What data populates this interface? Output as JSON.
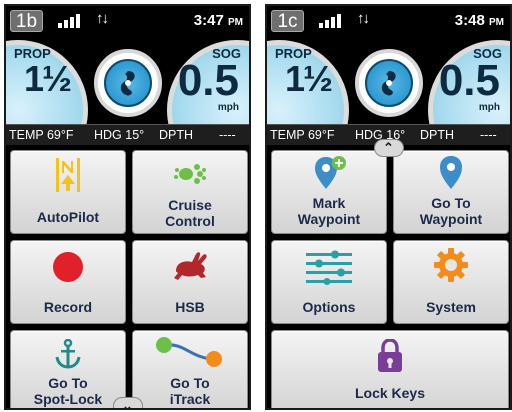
{
  "screens": [
    {
      "label": "1b",
      "time": "3:47",
      "ampm": "PM",
      "arrows": "↑↓",
      "prop": {
        "label": "PROP",
        "value": "1½"
      },
      "sog": {
        "label": "SOG",
        "value": "0.5",
        "unit": "mph"
      },
      "info": {
        "temp": "TEMP 69°F",
        "hdg": "HDG 15°",
        "depth_label": "DPTH",
        "depth_value": "----"
      },
      "tiles": [
        {
          "label": "AutoPilot",
          "icon": "autopilot-icon"
        },
        {
          "label": "Cruise Control",
          "line1": "Cruise",
          "line2": "Control",
          "icon": "cruise-control-icon"
        },
        {
          "label": "Record",
          "icon": "record-icon"
        },
        {
          "label": "HSB",
          "icon": "rabbit-icon"
        },
        {
          "label": "Go To Spot-Lock",
          "line1": "Go To",
          "line2": "Spot-Lock",
          "icon": "anchor-icon"
        },
        {
          "label": "Go To iTrack",
          "line1": "Go To",
          "line2": "iTrack",
          "icon": "itrack-icon"
        }
      ],
      "scroll_arrow": "⌄"
    },
    {
      "label": "1c",
      "time": "3:48",
      "ampm": "PM",
      "arrows": "↑↓",
      "prop": {
        "label": "PROP",
        "value": "1½"
      },
      "sog": {
        "label": "SOG",
        "value": "0.5",
        "unit": "mph"
      },
      "info": {
        "temp": "TEMP 69°F",
        "hdg": "HDG 16°",
        "depth_label": "DPTH",
        "depth_value": "----"
      },
      "tiles": [
        {
          "label": "Mark Waypoint",
          "line1": "Mark",
          "line2": "Waypoint",
          "icon": "mark-waypoint-icon"
        },
        {
          "label": "Go To Waypoint",
          "line1": "Go To",
          "line2": "Waypoint",
          "icon": "waypoint-pin-icon"
        },
        {
          "label": "Options",
          "icon": "sliders-icon"
        },
        {
          "label": "System",
          "icon": "gear-icon"
        },
        {
          "label": "Lock Keys",
          "icon": "padlock-icon"
        }
      ],
      "scroll_arrow": "⌃"
    }
  ],
  "colors": {
    "gauge": "#a9dcef",
    "tile_text": "#1b2a4a",
    "autopilot_yellow": "#f3c21b",
    "green": "#6cc04a",
    "record_red": "#e0202a",
    "hsb_red": "#b3262b",
    "teal": "#1f8a8a",
    "blue": "#3d8ec8",
    "orange": "#f28c1c",
    "purple": "#7a3d98"
  }
}
